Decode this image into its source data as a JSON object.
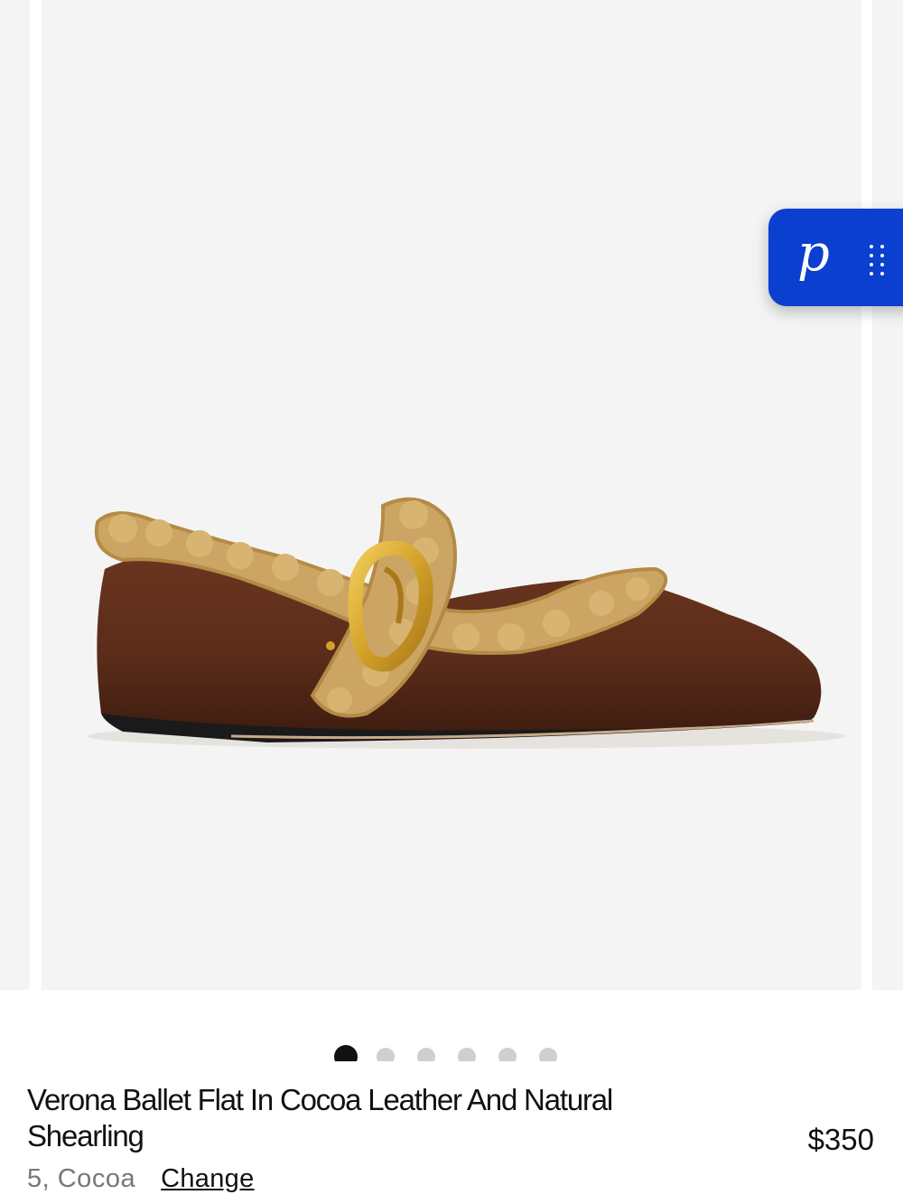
{
  "gallery": {
    "image_alt": "Brown leather ballet flat with shearling trim and gold buckle strap",
    "slide_count": 6,
    "active_slide": 1
  },
  "widget": {
    "logo": "p",
    "icon": "drag-handle-icon",
    "color": "#0b3fd0"
  },
  "product": {
    "title": "Verona Ballet Flat In Cocoa Leather And Natural Shearling",
    "price": "$350",
    "variant": "5, Cocoa",
    "change_label": "Change"
  },
  "colors": {
    "background": "#f4f4f4",
    "leather": "#5e2f1c",
    "shearling": "#cfa867",
    "buckle": "#d9a92b",
    "accent": "#0b3fd0"
  }
}
